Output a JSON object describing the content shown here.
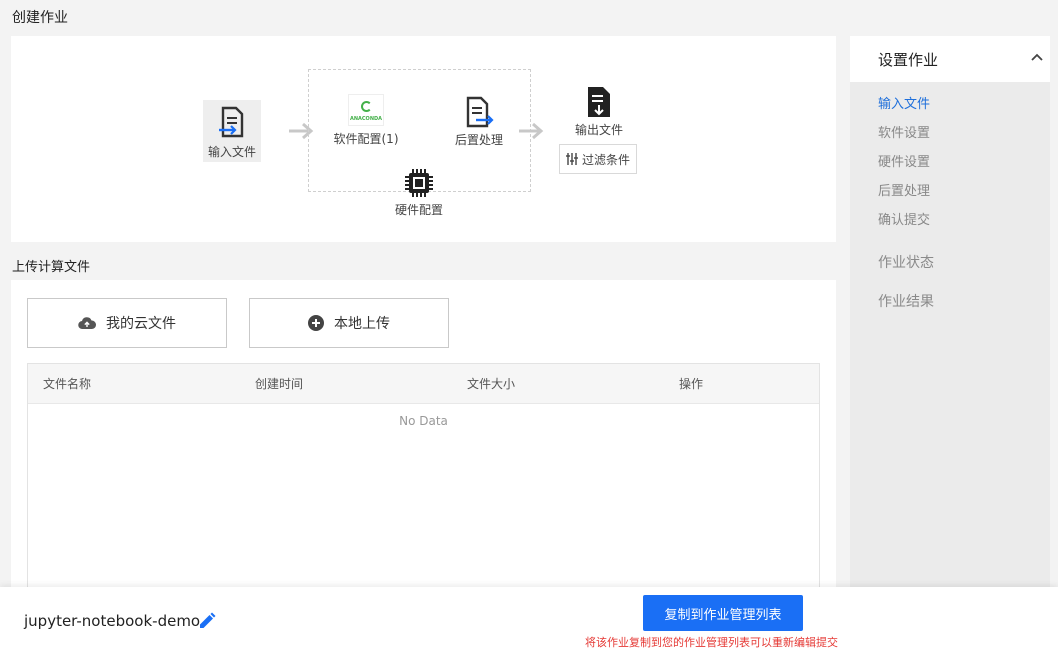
{
  "page": {
    "title": "创建作业"
  },
  "workflow": {
    "input_label": "输入文件",
    "software_label": "软件配置(1)",
    "software_logo_text": "ANACONDA",
    "post_label": "后置处理",
    "hardware_label": "硬件配置",
    "output_label": "输出文件",
    "filter_label": "过滤条件"
  },
  "upload": {
    "section_title": "上传计算文件",
    "cloud_button": "我的云文件",
    "local_button": "本地上传",
    "table": {
      "columns": [
        "文件名称",
        "创建时间",
        "文件大小",
        "操作"
      ],
      "empty_text": "No Data",
      "rows": []
    }
  },
  "sidebar": {
    "title": "设置作业",
    "steps": [
      {
        "label": "输入文件",
        "active": true
      },
      {
        "label": "软件设置",
        "active": false
      },
      {
        "label": "硬件设置",
        "active": false
      },
      {
        "label": "后置处理",
        "active": false
      },
      {
        "label": "确认提交",
        "active": false
      }
    ],
    "groups": [
      "作业状态",
      "作业结果"
    ]
  },
  "footer": {
    "job_name": "jupyter-notebook-demo",
    "copy_button": "复制到作业管理列表",
    "copy_hint": "将该作业复制到您的作业管理列表可以重新编辑提交"
  },
  "colors": {
    "accent": "#1a6ff5",
    "active_link": "#1e6fdb",
    "hint": "#e53935",
    "anaconda": "#43b049"
  },
  "icons": [
    "input-file-icon",
    "arrow-right-icon",
    "anaconda-logo",
    "post-process-icon",
    "cpu-chip-icon",
    "output-file-icon",
    "filter-icon",
    "cloud-icon",
    "plus-circle-icon",
    "chevron-up-icon",
    "edit-icon"
  ]
}
